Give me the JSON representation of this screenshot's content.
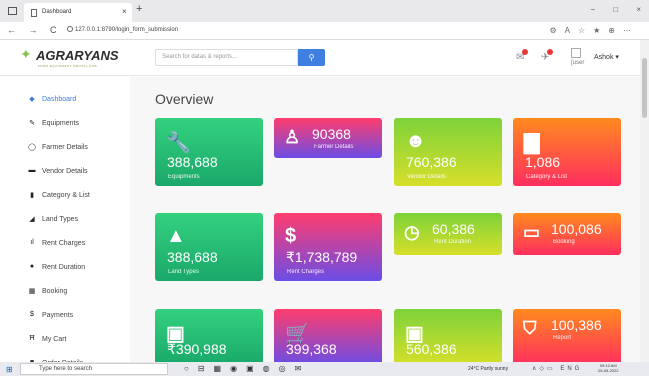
{
  "browser": {
    "tab_title": "Dashboard",
    "tab_close": "×",
    "new_tab": "+",
    "url": "127.0.0.1:8790/login_form_submission",
    "window_controls": [
      "−",
      "□",
      "×"
    ],
    "nav": [
      "←",
      "→",
      "C"
    ]
  },
  "header": {
    "logo_text": "AGRARYANS",
    "logo_tagline": "FARM EQUIPMENT RENTAL HUB",
    "search_placeholder": "Search for datas & reports...",
    "search_button_icon": "search-icon",
    "avatar_alt": "[user",
    "user_name": "Ashok ▾"
  },
  "sidebar": {
    "items": [
      {
        "label": "Dashboard",
        "icon": "dashboard-icon",
        "glyph": "◆",
        "active": true
      },
      {
        "label": "Equipments",
        "icon": "wrench-icon",
        "glyph": "✎"
      },
      {
        "label": "Farmer Details",
        "icon": "user-icon",
        "glyph": "◯"
      },
      {
        "label": "Vendor Details",
        "icon": "id-card-icon",
        "glyph": "▬"
      },
      {
        "label": "Category & List",
        "icon": "copy-icon",
        "glyph": "▮"
      },
      {
        "label": "Land Types",
        "icon": "leaf-icon",
        "glyph": "◢"
      },
      {
        "label": "Rent Charges",
        "icon": "chart-icon",
        "glyph": "ıl"
      },
      {
        "label": "Rent Duration",
        "icon": "clock-icon",
        "glyph": "●"
      },
      {
        "label": "Booking",
        "icon": "table-icon",
        "glyph": "▦"
      },
      {
        "label": "Payments",
        "icon": "dollar-icon",
        "glyph": "$"
      },
      {
        "label": "My Cart",
        "icon": "cart-icon",
        "glyph": "Ħ"
      },
      {
        "label": "Order Details",
        "icon": "truck-icon",
        "glyph": "■"
      }
    ]
  },
  "main": {
    "title": "Overview",
    "cards": [
      {
        "value": "388,688",
        "label": "Equipments",
        "icon": "wrench-icon",
        "glyph": "🔧",
        "gradient": "g1",
        "layout": "stack"
      },
      {
        "value": "90368",
        "label": "Farmer Details",
        "icon": "user-icon",
        "glyph": "♙",
        "gradient": "g2",
        "layout": "inline"
      },
      {
        "value": "760,386",
        "label": "Vendor Details",
        "icon": "smile-icon",
        "glyph": "☻",
        "gradient": "g3",
        "layout": "stack"
      },
      {
        "value": "1,086",
        "label": "Category & List",
        "icon": "folder-icon",
        "glyph": "▇",
        "gradient": "g4",
        "layout": "stack"
      },
      {
        "value": "388,688",
        "label": "Land Types",
        "icon": "mountain-icon",
        "glyph": "▲",
        "gradient": "g1",
        "layout": "stack"
      },
      {
        "value": "₹1,738,789",
        "label": "Rent Charges",
        "icon": "dollar-icon",
        "glyph": "$",
        "gradient": "g2",
        "layout": "stack"
      },
      {
        "value": "60,386",
        "label": "Rent Duration",
        "icon": "clock-icon",
        "glyph": "◷",
        "gradient": "g3",
        "layout": "inline"
      },
      {
        "value": "100,086",
        "label": "Booking",
        "icon": "monitor-icon",
        "glyph": "▭",
        "gradient": "g4",
        "layout": "inline"
      },
      {
        "value": "₹390,988",
        "label": "",
        "icon": "wallet-icon",
        "glyph": "▣",
        "gradient": "g1",
        "layout": "stack"
      },
      {
        "value": "399,368",
        "label": "",
        "icon": "cart-icon",
        "glyph": "🛒",
        "gradient": "g2",
        "layout": "stack"
      },
      {
        "value": "560,386",
        "label": "",
        "icon": "image-icon",
        "glyph": "▣",
        "gradient": "g3",
        "layout": "stack"
      },
      {
        "value": "100,386",
        "label": "Report",
        "icon": "shield-icon",
        "glyph": "⛉",
        "gradient": "g4",
        "layout": "inline"
      }
    ]
  },
  "taskbar": {
    "search_placeholder": "Type here to search",
    "weather": "24°C Partly sunny",
    "tray_lang": "ENG",
    "time": "09:12 AM",
    "date": "25-05-2022"
  }
}
